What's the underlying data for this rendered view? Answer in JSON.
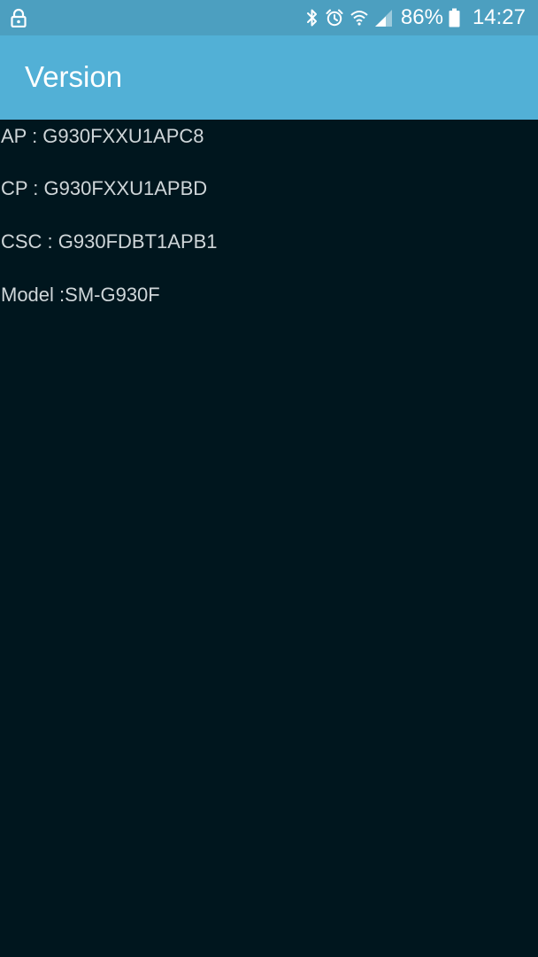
{
  "status_bar": {
    "left_icon": "lock-icon",
    "icons": [
      "bluetooth-icon",
      "alarm-icon",
      "wifi-icon",
      "signal-icon"
    ],
    "battery_percent": "86%",
    "time": "14:27"
  },
  "app_bar": {
    "title": "Version"
  },
  "version_info": [
    "AP : G930FXXU1APC8",
    "CP : G930FXXU1APBD",
    "CSC : G930FDBT1APB1",
    "Model :SM-G930F"
  ],
  "colors": {
    "status_bar_bg": "#4c9fc0",
    "app_bar_bg": "#52b0d6",
    "content_bg": "#00161e",
    "text": "#cfd6d9"
  }
}
